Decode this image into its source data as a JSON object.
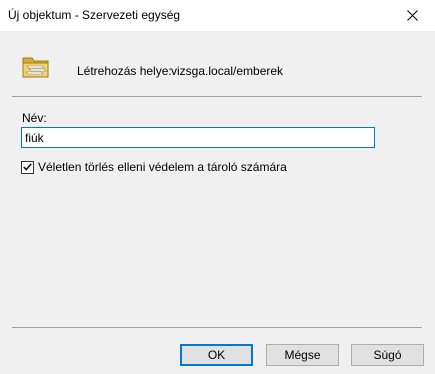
{
  "window": {
    "title": "Új objektum - Szervezeti egység"
  },
  "location": {
    "label": "Létrehozás helye:",
    "value": "vizsga.local/emberek"
  },
  "name_field": {
    "label": "Név:",
    "value": "fiúk"
  },
  "protect_checkbox": {
    "label": "Véletlen törlés elleni védelem a tároló számára",
    "checked": true
  },
  "buttons": {
    "ok": "OK",
    "cancel": "Mégse",
    "help": "Súgó"
  },
  "icons": {
    "close": "close-icon",
    "ou": "organizational-unit-folder-icon",
    "check": "checkmark-icon"
  },
  "colors": {
    "focus_accent": "#0078d7",
    "folder_yellow": "#e8c44c",
    "dialog_bg": "#f0f0f0"
  }
}
